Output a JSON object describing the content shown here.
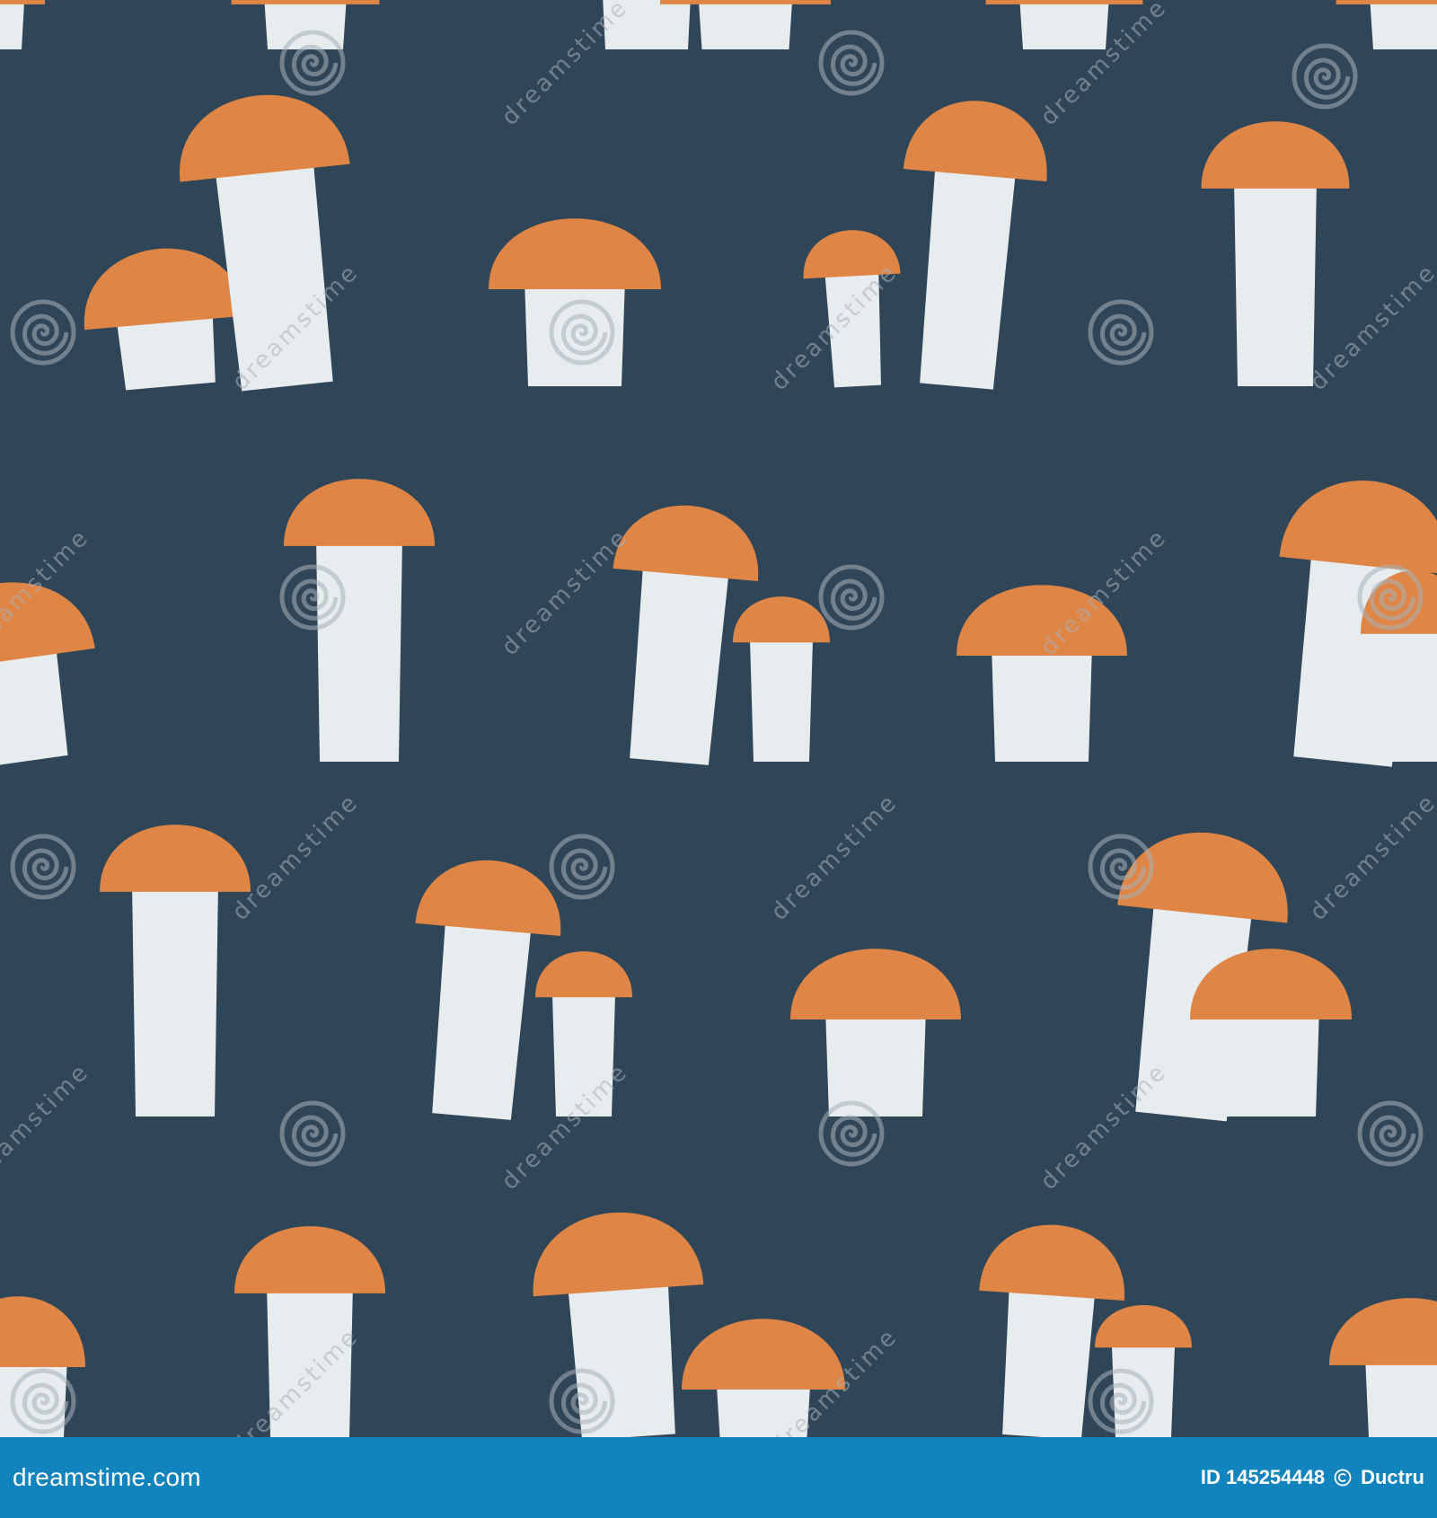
{
  "colors": {
    "background": "#2f4558",
    "cap": "#df8646",
    "stem": "#e7ecef",
    "footer_background": "#1183bd",
    "footer_text": "#ffffff",
    "watermark": "#a7b2bb"
  },
  "watermark": {
    "text": "dreamstime",
    "logo_icon": "spiral-logo-icon"
  },
  "footer": {
    "site": "dreamstime.com",
    "id_label": "ID 145254448",
    "author_icon": "copyright-icon",
    "author": "Ductru"
  }
}
